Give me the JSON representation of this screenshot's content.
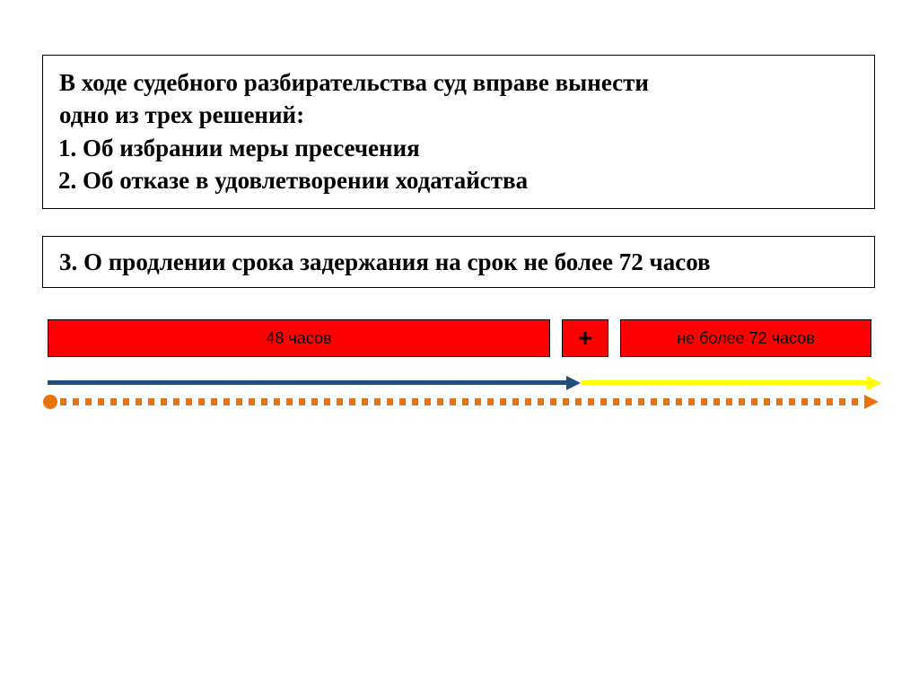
{
  "box1": {
    "intro_line1": "В ходе судебного разбирательства суд вправе вынести",
    "intro_line2": "одно из трех решений:",
    "item1": "Об избрании меры пресечения",
    "item2": "Об отказе в удовлетворении ходатайства"
  },
  "box2": {
    "text": "3. О продлении срока задержания на срок не более 72 часов"
  },
  "timeline": {
    "first_segment": "48 часов",
    "plus": "+",
    "second_segment": "не более 72 часов"
  }
}
